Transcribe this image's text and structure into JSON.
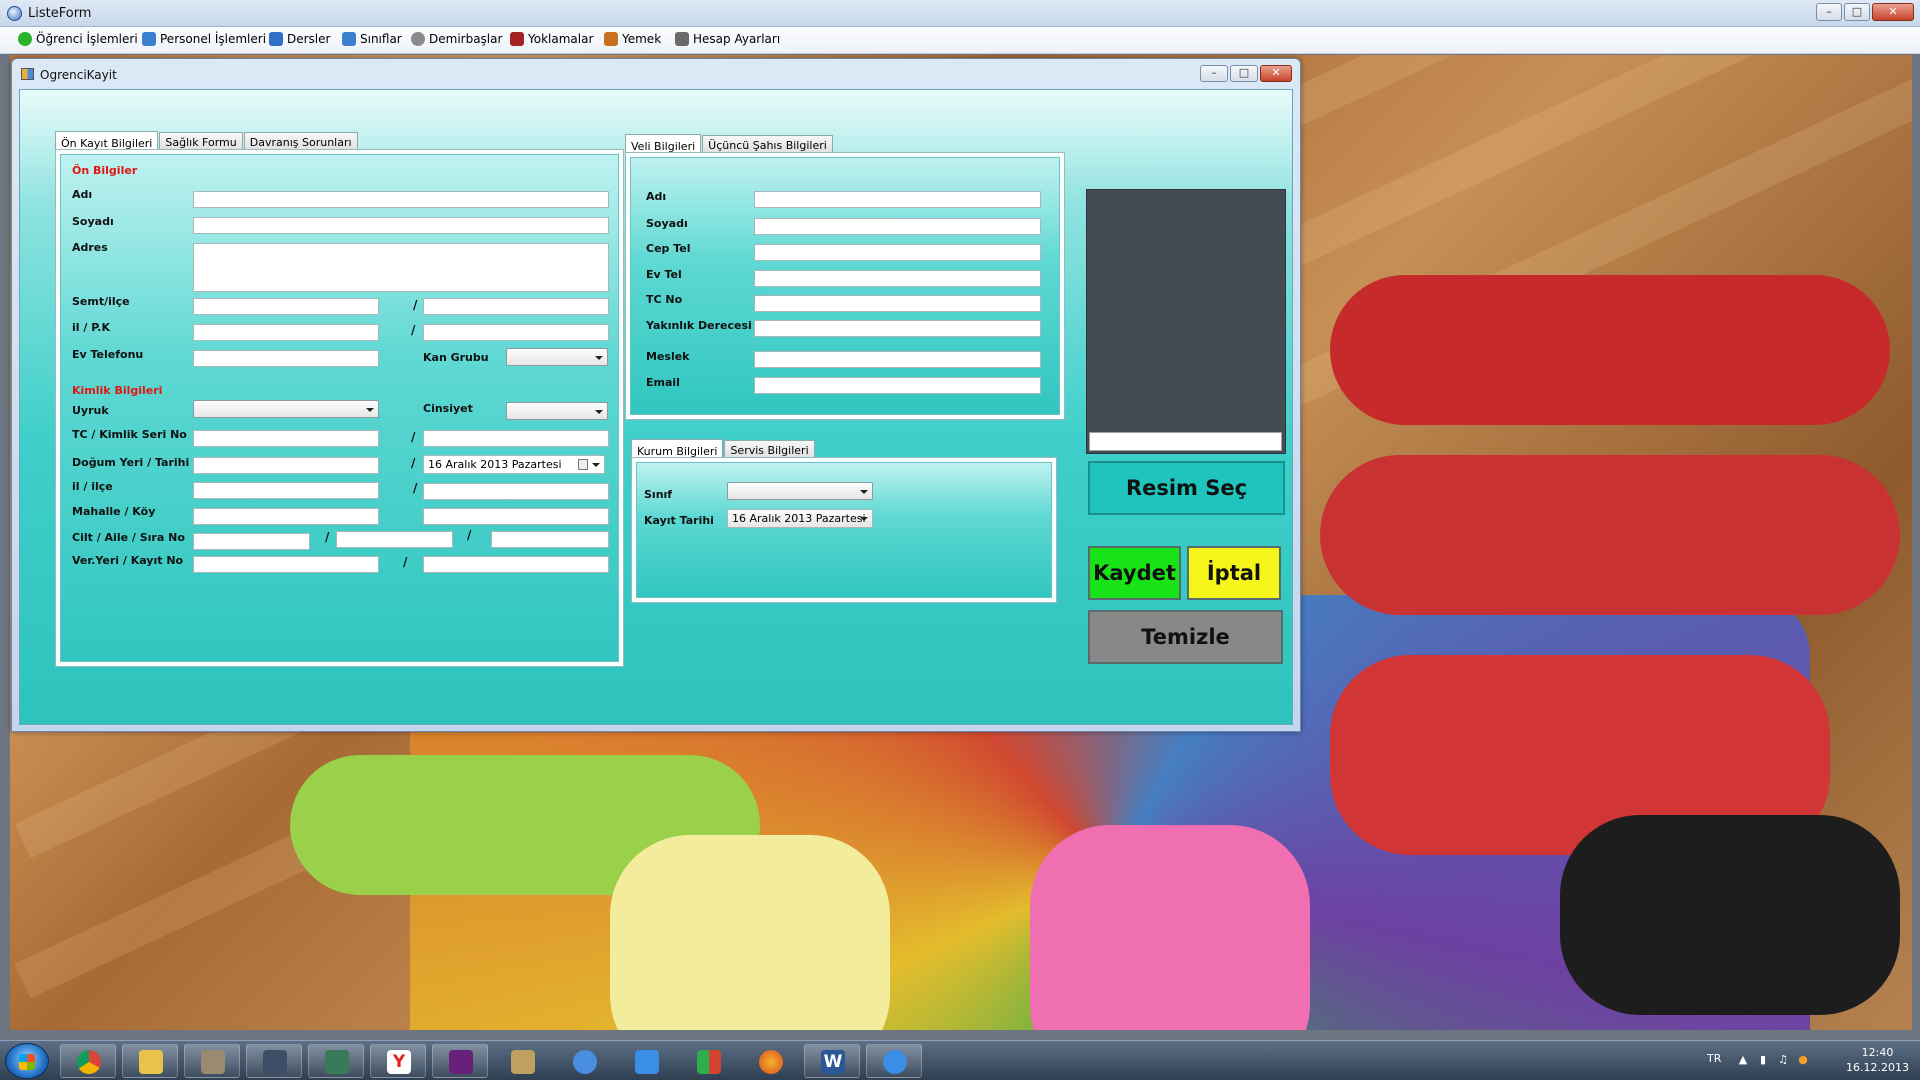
{
  "window": {
    "title": "ListeForm"
  },
  "menu": [
    {
      "label": "Öğrenci İşlemleri",
      "icon": "student-icon",
      "color": "#2bb32b"
    },
    {
      "label": "Personel İşlemleri",
      "icon": "personnel-icon",
      "color": "#3a7fd0"
    },
    {
      "label": "Dersler",
      "icon": "lessons-icon",
      "color": "#2f6fc6"
    },
    {
      "label": "Sınıflar",
      "icon": "classes-icon",
      "color": "#3a7fd0"
    },
    {
      "label": "Demirbaşlar",
      "icon": "fixtures-icon",
      "color": "#8a8a8a"
    },
    {
      "label": "Yoklamalar",
      "icon": "attendance-icon",
      "color": "#a52222"
    },
    {
      "label": "Yemek",
      "icon": "food-icon",
      "color": "#c8711e"
    },
    {
      "label": "Hesap Ayarları",
      "icon": "account-icon",
      "color": "#6a6a6a"
    }
  ],
  "child": {
    "title": "OgrenciKayit"
  },
  "left_tabs": [
    "Ön Kayıt Bilgileri",
    "Sağlık Formu",
    "Davranış Sorunları"
  ],
  "ogrenci": {
    "section_on": "Ön Bilgiler",
    "adi": "Adı",
    "soyadi": "Soyadı",
    "adres": "Adres",
    "semt": "Semt/ilçe",
    "il_pk": "il / P.K",
    "ev_tel": "Ev Telefonu",
    "kan_grubu": "Kan Grubu",
    "section_kimlik": "Kimlik Bilgileri",
    "uyruk": "Uyruk",
    "cinsiyet": "Cinsiyet",
    "tc": "TC / Kimlik Seri No",
    "dogum": "Doğum Yeri / Tarihi",
    "dogum_tarihi": "16   Aralık   2013  Pazartesi",
    "il_ilce": "il / ilçe",
    "mahalle": "Mahalle / Köy",
    "cilt": "Cilt / Aile / Sıra No",
    "ver_yeri": "Ver.Yeri / Kayıt No",
    "slash": "/"
  },
  "veli_tabs": [
    "Veli Bilgileri",
    "Üçüncü Şahıs Bilgileri"
  ],
  "veli": {
    "adi": "Adı",
    "soyadi": "Soyadı",
    "cep_tel": "Cep Tel",
    "ev_tel": "Ev Tel",
    "tc_no": "TC No",
    "yakinlik": "Yakınlık Derecesi",
    "meslek": "Meslek",
    "email": "Email"
  },
  "kurum_tabs": [
    "Kurum Bilgileri",
    "Servis Bilgileri"
  ],
  "kurum": {
    "sinif": "Sınıf",
    "kayit_tarihi": "Kayıt Tarihi",
    "kayit_tarihi_value": "16   Aralık   2013  Pazartesi"
  },
  "buttons": {
    "resim_sec": "Resim Seç",
    "kaydet": "Kaydet",
    "iptal": "İptal",
    "temizle": "Temizle"
  },
  "taskbar": {
    "lang": "TR",
    "time": "12:40",
    "date": "16.12.2013",
    "apps": [
      {
        "name": "chrome-icon",
        "color": "#e0463a"
      },
      {
        "name": "explorer-folder-icon",
        "color": "#e8c24a"
      },
      {
        "name": "books-icon",
        "color": "#9a8a70"
      },
      {
        "name": "media-icon",
        "color": "#3c4d66"
      },
      {
        "name": "app-icon",
        "color": "#3a7a5a"
      },
      {
        "name": "yandex-icon",
        "color": "#ffffff"
      },
      {
        "name": "visual-studio-icon",
        "color": "#68217a"
      },
      {
        "name": "tools-icon",
        "color": "#c0a060"
      },
      {
        "name": "outlook-icon",
        "color": "#4a8ee0"
      },
      {
        "name": "app-store-icon",
        "color": "#3a8ee6"
      },
      {
        "name": "transfer-icon",
        "color": "#2fae4e"
      },
      {
        "name": "firefox-icon",
        "color": "#d87a1e"
      },
      {
        "name": "word-icon",
        "color": "#2b5797"
      },
      {
        "name": "download-icon",
        "color": "#3a8ee6"
      }
    ]
  }
}
